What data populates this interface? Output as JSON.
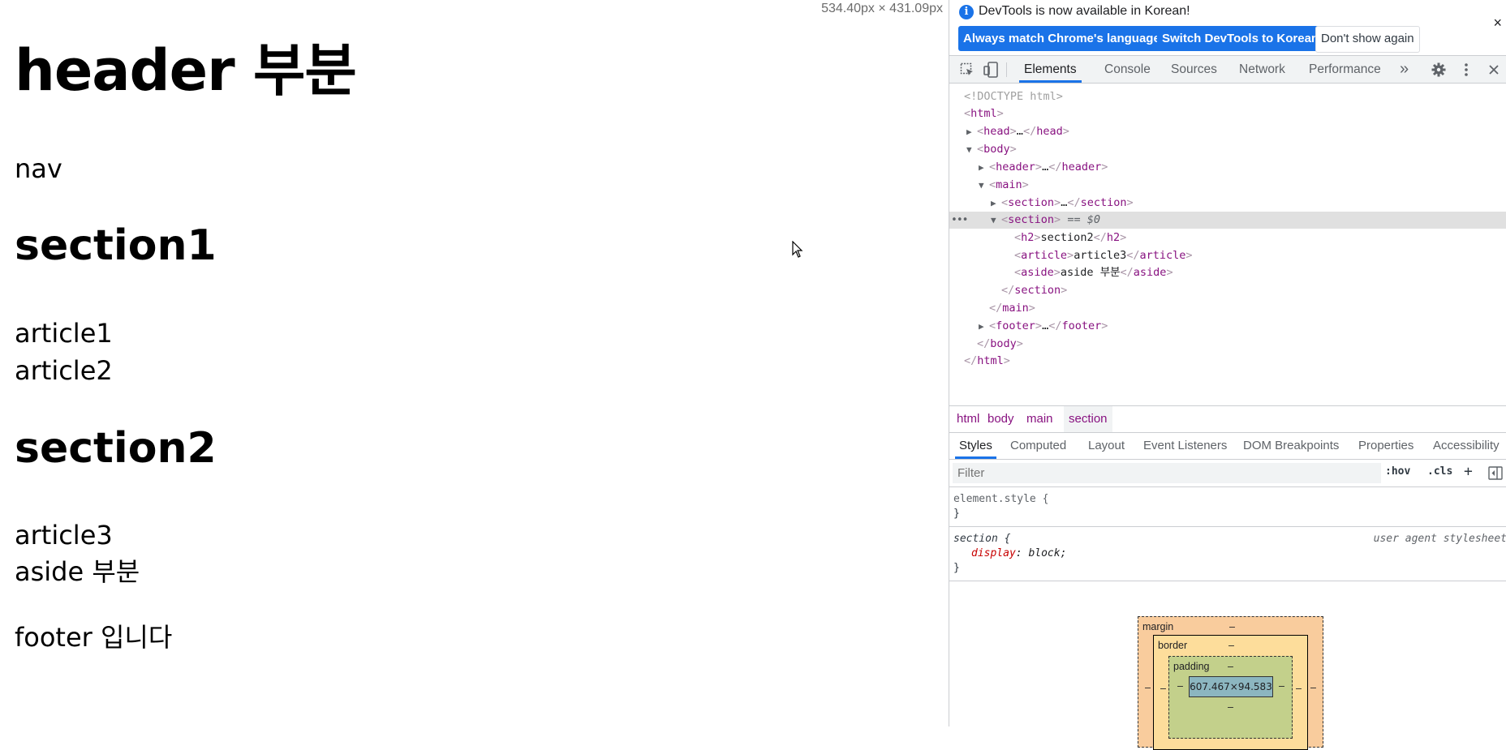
{
  "page": {
    "size_readout": "534.40px × 431.09px",
    "header": "header 부분",
    "nav": "nav",
    "section1_title": "section1",
    "article1": "article1",
    "article2": "article2",
    "section2_title": "section2",
    "article3": "article3",
    "aside": "aside 부분",
    "footer": "footer 입니다"
  },
  "devtools": {
    "infobar": {
      "message": "DevTools is now available in Korean!",
      "btn_match": "Always match Chrome's language",
      "btn_switch": "Switch DevTools to Korean",
      "btn_dismiss": "Don't show again",
      "close": "×"
    },
    "tabs": [
      "Elements",
      "Console",
      "Sources",
      "Network",
      "Performance"
    ],
    "more_tabs": "»",
    "dom": {
      "doctype": "<!DOCTYPE html>",
      "selected_marker": "== $0",
      "h2_text": "section2",
      "article_text": "article3",
      "aside_text": "aside 부분"
    },
    "breadcrumbs": [
      "html",
      "body",
      "main",
      "section"
    ],
    "subtabs": [
      "Styles",
      "Computed",
      "Layout",
      "Event Listeners",
      "DOM Breakpoints",
      "Properties",
      "Accessibility"
    ],
    "filter_placeholder": "Filter",
    "hov": ":hov",
    "cls": ".cls",
    "plus": "+",
    "rules": {
      "element_style": "element.style {",
      "close_brace": "}",
      "section_selector": "section {",
      "source": "user agent stylesheet",
      "prop_name": "display",
      "prop_value": "block;"
    },
    "boxmodel": {
      "margin": "margin",
      "border": "border",
      "padding": "padding",
      "content": "607.467×94.583",
      "dash": "–"
    }
  }
}
